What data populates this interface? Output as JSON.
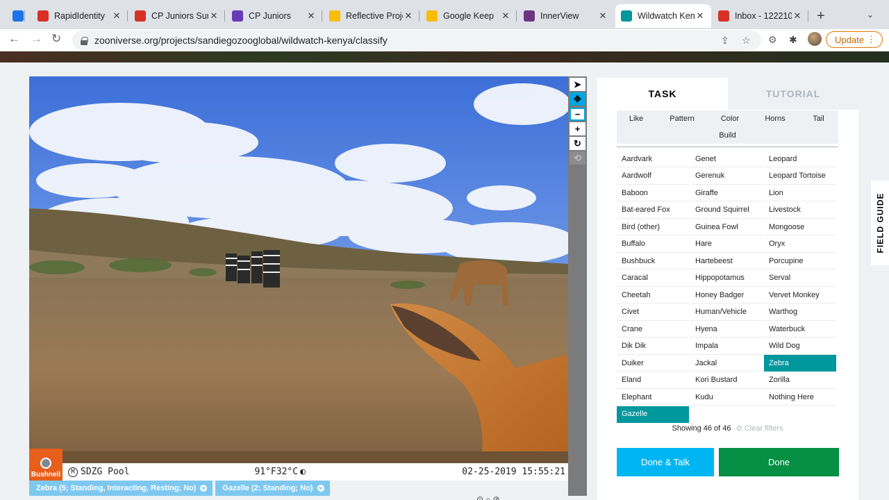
{
  "browser": {
    "tabs": [
      {
        "title": "",
        "favicon": "calendar-icon",
        "color": "#1a73e8"
      },
      {
        "title": "RapidIdentity",
        "favicon": "rapididentity-icon",
        "color": "#d93025"
      },
      {
        "title": "CP Juniors Sum",
        "favicon": "ring-icon",
        "color": "#d93025"
      },
      {
        "title": "CP Juniors",
        "favicon": "forms-icon",
        "color": "#673ab7"
      },
      {
        "title": "Reflective Proje",
        "favicon": "drive-icon",
        "color": "#fbbc04"
      },
      {
        "title": "Google Keep",
        "favicon": "keep-icon",
        "color": "#fbbc04"
      },
      {
        "title": "InnerView",
        "favicon": "innerview-icon",
        "color": "#6c3483"
      },
      {
        "title": "Wildwatch Ken",
        "favicon": "zooniverse-icon",
        "color": "#00979d"
      },
      {
        "title": "Inbox - 122210",
        "favicon": "gmail-icon",
        "color": "#d93025"
      }
    ],
    "url": "zooniverse.org/projects/sandiegozooglobal/wildwatch-kenya/classify",
    "update_label": "Update"
  },
  "viewer": {
    "stamp": {
      "brand": "Bushnell",
      "camera": "SDZG Pool",
      "temp": "91°F32°C",
      "datetime": "02-25-2019 15:55:21"
    },
    "chips": [
      {
        "label": "Zebra (5; Standing, Interacting, Resting; No)"
      },
      {
        "label": "Gazelle (2; Standing; No)"
      }
    ]
  },
  "panel": {
    "task_tab": "TASK",
    "tutorial_tab": "TUTORIAL",
    "filters": [
      "Like",
      "Pattern",
      "Color",
      "Horns",
      "Tail",
      "Build"
    ],
    "choices": [
      [
        "Aardvark",
        "Genet",
        "Leopard"
      ],
      [
        "Aardwolf",
        "Gerenuk",
        "Leopard Tortoise"
      ],
      [
        "Baboon",
        "Giraffe",
        "Lion"
      ],
      [
        "Bat-eared Fox",
        "Ground Squirrel",
        "Livestock"
      ],
      [
        "Bird (other)",
        "Guinea Fowl",
        "Mongoose"
      ],
      [
        "Buffalo",
        "Hare",
        "Oryx"
      ],
      [
        "Bushbuck",
        "Hartebeest",
        "Porcupine"
      ],
      [
        "Caracal",
        "Hippopotamus",
        "Serval"
      ],
      [
        "Cheetah",
        "Honey Badger",
        "Vervet Monkey"
      ],
      [
        "Civet",
        "Human/Vehicle",
        "Warthog"
      ],
      [
        "Crane",
        "Hyena",
        "Waterbuck"
      ],
      [
        "Dik Dik",
        "Impala",
        "Wild Dog"
      ],
      [
        "Duiker",
        "Jackal",
        "Zebra"
      ],
      [
        "Eland",
        "Kori Bustard",
        "Zorilla"
      ],
      [
        "Elephant",
        "Kudu",
        "Nothing Here"
      ],
      [
        "Gazelle"
      ]
    ],
    "selected": [
      "Zebra",
      "Gazelle"
    ],
    "showing": "Showing 46 of 46",
    "clear_filters": "Clear filters",
    "done_talk": "Done & Talk",
    "done": "Done",
    "field_guide": "FIELD GUIDE"
  },
  "colors": {
    "selected": "#00979d",
    "done": "#058f44",
    "done_talk": "#00b6f2",
    "chip": "#7ec8f0"
  }
}
